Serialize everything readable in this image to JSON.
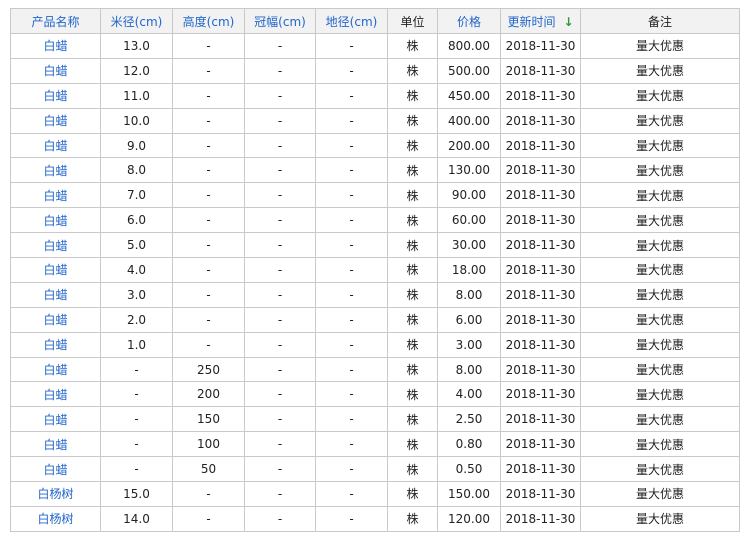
{
  "columns": [
    {
      "label": "产品名称",
      "link": true
    },
    {
      "label": "米径(cm)",
      "link": true
    },
    {
      "label": "高度(cm)",
      "link": true
    },
    {
      "label": "冠幅(cm)",
      "link": true
    },
    {
      "label": "地径(cm)",
      "link": true
    },
    {
      "label": "单位",
      "link": false
    },
    {
      "label": "价格",
      "link": true
    },
    {
      "label": "更新时间",
      "link": true
    },
    {
      "label": "备注",
      "link": false
    }
  ],
  "sort_icon": "arrow-down-icon",
  "sort_color": "#2c9a3b",
  "link_color": "#2266cc",
  "rows": [
    [
      "白蜡",
      "13.0",
      "-",
      "-",
      "-",
      "株",
      "800.00",
      "2018-11-30",
      "量大优惠"
    ],
    [
      "白蜡",
      "12.0",
      "-",
      "-",
      "-",
      "株",
      "500.00",
      "2018-11-30",
      "量大优惠"
    ],
    [
      "白蜡",
      "11.0",
      "-",
      "-",
      "-",
      "株",
      "450.00",
      "2018-11-30",
      "量大优惠"
    ],
    [
      "白蜡",
      "10.0",
      "-",
      "-",
      "-",
      "株",
      "400.00",
      "2018-11-30",
      "量大优惠"
    ],
    [
      "白蜡",
      "9.0",
      "-",
      "-",
      "-",
      "株",
      "200.00",
      "2018-11-30",
      "量大优惠"
    ],
    [
      "白蜡",
      "8.0",
      "-",
      "-",
      "-",
      "株",
      "130.00",
      "2018-11-30",
      "量大优惠"
    ],
    [
      "白蜡",
      "7.0",
      "-",
      "-",
      "-",
      "株",
      "90.00",
      "2018-11-30",
      "量大优惠"
    ],
    [
      "白蜡",
      "6.0",
      "-",
      "-",
      "-",
      "株",
      "60.00",
      "2018-11-30",
      "量大优惠"
    ],
    [
      "白蜡",
      "5.0",
      "-",
      "-",
      "-",
      "株",
      "30.00",
      "2018-11-30",
      "量大优惠"
    ],
    [
      "白蜡",
      "4.0",
      "-",
      "-",
      "-",
      "株",
      "18.00",
      "2018-11-30",
      "量大优惠"
    ],
    [
      "白蜡",
      "3.0",
      "-",
      "-",
      "-",
      "株",
      "8.00",
      "2018-11-30",
      "量大优惠"
    ],
    [
      "白蜡",
      "2.0",
      "-",
      "-",
      "-",
      "株",
      "6.00",
      "2018-11-30",
      "量大优惠"
    ],
    [
      "白蜡",
      "1.0",
      "-",
      "-",
      "-",
      "株",
      "3.00",
      "2018-11-30",
      "量大优惠"
    ],
    [
      "白蜡",
      "-",
      "250",
      "-",
      "-",
      "株",
      "8.00",
      "2018-11-30",
      "量大优惠"
    ],
    [
      "白蜡",
      "-",
      "200",
      "-",
      "-",
      "株",
      "4.00",
      "2018-11-30",
      "量大优惠"
    ],
    [
      "白蜡",
      "-",
      "150",
      "-",
      "-",
      "株",
      "2.50",
      "2018-11-30",
      "量大优惠"
    ],
    [
      "白蜡",
      "-",
      "100",
      "-",
      "-",
      "株",
      "0.80",
      "2018-11-30",
      "量大优惠"
    ],
    [
      "白蜡",
      "-",
      "50",
      "-",
      "-",
      "株",
      "0.50",
      "2018-11-30",
      "量大优惠"
    ],
    [
      "白杨树",
      "15.0",
      "-",
      "-",
      "-",
      "株",
      "150.00",
      "2018-11-30",
      "量大优惠"
    ],
    [
      "白杨树",
      "14.0",
      "-",
      "-",
      "-",
      "株",
      "120.00",
      "2018-11-30",
      "量大优惠"
    ]
  ]
}
